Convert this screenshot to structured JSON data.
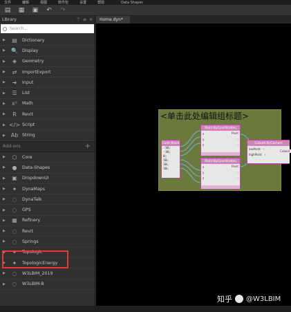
{
  "menubar": {
    "items": [
      "文件",
      "编辑",
      "视图",
      "软件包",
      "设置",
      "帮助"
    ],
    "extra": "Data Shapes"
  },
  "library": {
    "title": "Library",
    "search_placeholder": "Search...",
    "items": [
      {
        "label": "Dictionary",
        "icon": "dictionary-icon",
        "glyph": "▤"
      },
      {
        "label": "Display",
        "icon": "display-icon",
        "glyph": "🔍"
      },
      {
        "label": "Geometry",
        "icon": "geometry-icon",
        "glyph": "◈"
      },
      {
        "label": "ImportExport",
        "icon": "import-export-icon",
        "glyph": "⇄"
      },
      {
        "label": "Input",
        "icon": "input-icon",
        "glyph": "➜"
      },
      {
        "label": "List",
        "icon": "list-icon",
        "glyph": "☰"
      },
      {
        "label": "Math",
        "icon": "math-icon",
        "glyph": "x²"
      },
      {
        "label": "Revit",
        "icon": "revit-icon",
        "glyph": "R"
      },
      {
        "label": "Script",
        "icon": "script-icon",
        "glyph": "</>"
      },
      {
        "label": "String",
        "icon": "string-icon",
        "glyph": "Ab"
      }
    ],
    "addons_label": "Add-ons",
    "addons": [
      {
        "label": "Core",
        "icon": "core-icon",
        "glyph": "⬡"
      },
      {
        "label": "Data-Shapes",
        "icon": "data-shapes-icon",
        "glyph": "●"
      },
      {
        "label": "DropdownUI",
        "icon": "dropdown-icon",
        "glyph": "▣"
      },
      {
        "label": "DynaMaps",
        "icon": "dynamaps-icon",
        "glyph": "✦"
      },
      {
        "label": "DynaTalk",
        "icon": "dynatalk-icon",
        "glyph": "◌"
      },
      {
        "label": "GPS",
        "icon": "gps-icon",
        "glyph": "◌"
      },
      {
        "label": "Refinery",
        "icon": "refinery-icon",
        "glyph": "▦"
      },
      {
        "label": "Revit",
        "icon": "revit-addon-icon",
        "glyph": "◌"
      },
      {
        "label": "Springs",
        "icon": "springs-icon",
        "glyph": "◌"
      },
      {
        "label": "Topologic",
        "icon": "topologic-icon",
        "glyph": "✦"
      },
      {
        "label": "TopologicEnergy",
        "icon": "topologic-energy-icon",
        "glyph": "✦"
      },
      {
        "label": "W3LBIM_2019",
        "icon": "w3lbim-2019-icon",
        "glyph": "◌"
      },
      {
        "label": "W3LBIM-B",
        "icon": "w3lbim-b-icon",
        "glyph": "◌"
      }
    ]
  },
  "tab": {
    "label": "Home.dyn*"
  },
  "group": {
    "title": "<单击此处编辑组标题>"
  },
  "nodes": {
    "code_block": {
      "title": "Code Block",
      "lines": [
        "-10;",
        "-10;",
        "0;",
        "10;",
        "10;",
        "10;"
      ]
    },
    "point1": {
      "title": "Point.ByCoordinates",
      "inputs": [
        "x",
        "y",
        "z"
      ],
      "output": "Point"
    },
    "point2": {
      "title": "Point.ByCoordinates",
      "inputs": [
        "x",
        "y",
        "z"
      ],
      "output": "Point"
    },
    "cuboid": {
      "title": "Cuboid.ByCorners",
      "inputs": [
        "lowPoint",
        "highPoint"
      ],
      "output": "Cuboid"
    }
  },
  "watermark": {
    "text": "知乎",
    "handle": "@W3LBIM"
  },
  "status": {
    "items": [
      "",
      "",
      ""
    ]
  }
}
